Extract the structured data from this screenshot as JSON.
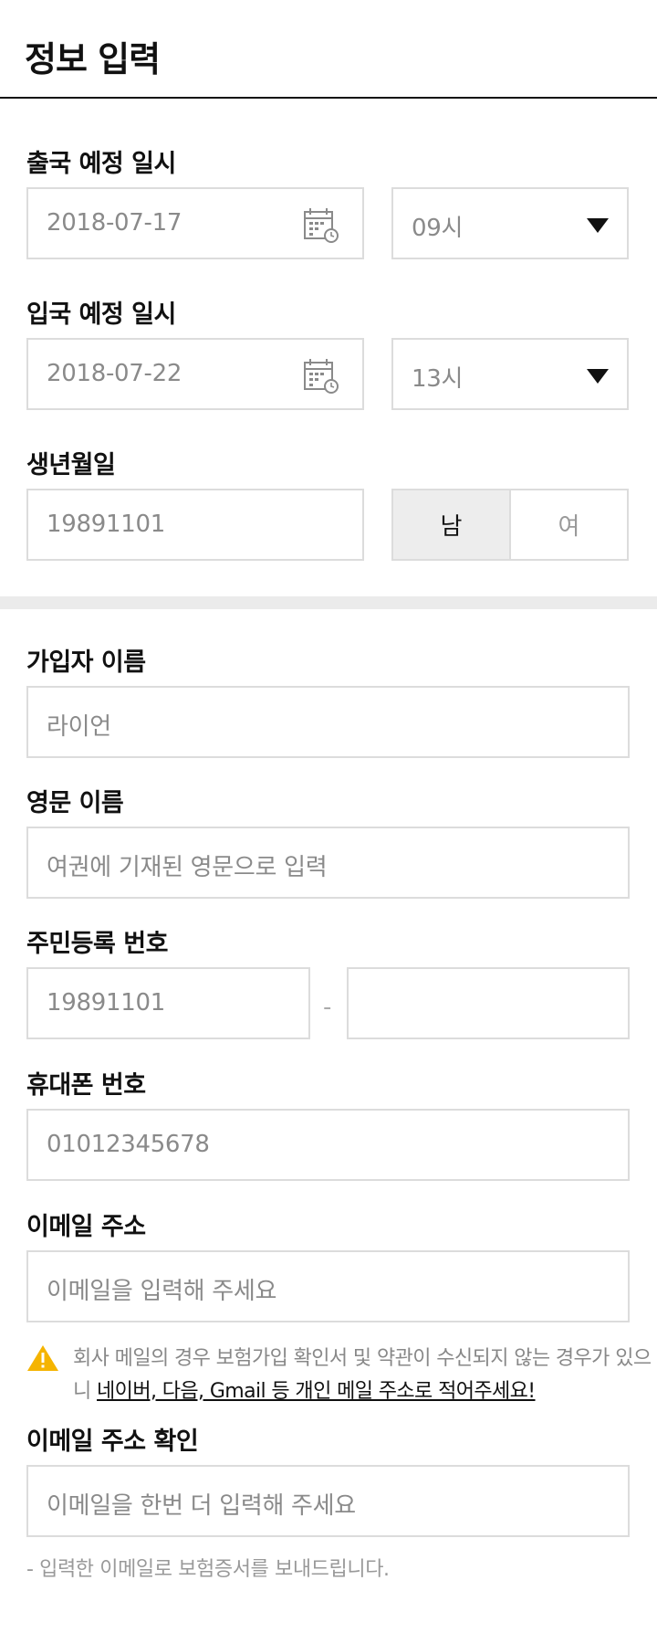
{
  "header": {
    "title": "정보 입력"
  },
  "departure": {
    "label": "출국 예정 일시",
    "date": "2018-07-17",
    "hour": "09시"
  },
  "arrival": {
    "label": "입국 예정 일시",
    "date": "2018-07-22",
    "hour": "13시"
  },
  "birth": {
    "label": "생년월일",
    "value": "19891101",
    "gender": {
      "male": "남",
      "female": "여",
      "selected": "남"
    }
  },
  "subscriber": {
    "label": "가입자 이름",
    "placeholder": "라이언"
  },
  "english_name": {
    "label": "영문 이름",
    "placeholder": "여권에 기재된 영문으로 입력"
  },
  "resident": {
    "label": "주민등록 번호",
    "front": "19891101",
    "separator": "-",
    "back": ""
  },
  "phone": {
    "label": "휴대폰 번호",
    "placeholder": "01012345678"
  },
  "email": {
    "label": "이메일 주소",
    "placeholder": "이메일을 입력해 주세요",
    "notice_prefix": "회사 메일의 경우 보험가입 확인서 및 약관이 수신되지 않는 경우가 있으니 ",
    "notice_link": "네이버, 다음, Gmail 등 개인 메일 주소로 적어주세요!"
  },
  "email_confirm": {
    "label": "이메일 주소 확인",
    "placeholder": "이메일을 한번 더 입력해 주세요",
    "footnote": "- 입력한 이메일로 보험증서를 보내드립니다."
  },
  "colors": {
    "border": "#dcdcdc",
    "placeholder": "#8a8a8a",
    "warning": "#f5b400",
    "selected_bg": "#ededed"
  }
}
